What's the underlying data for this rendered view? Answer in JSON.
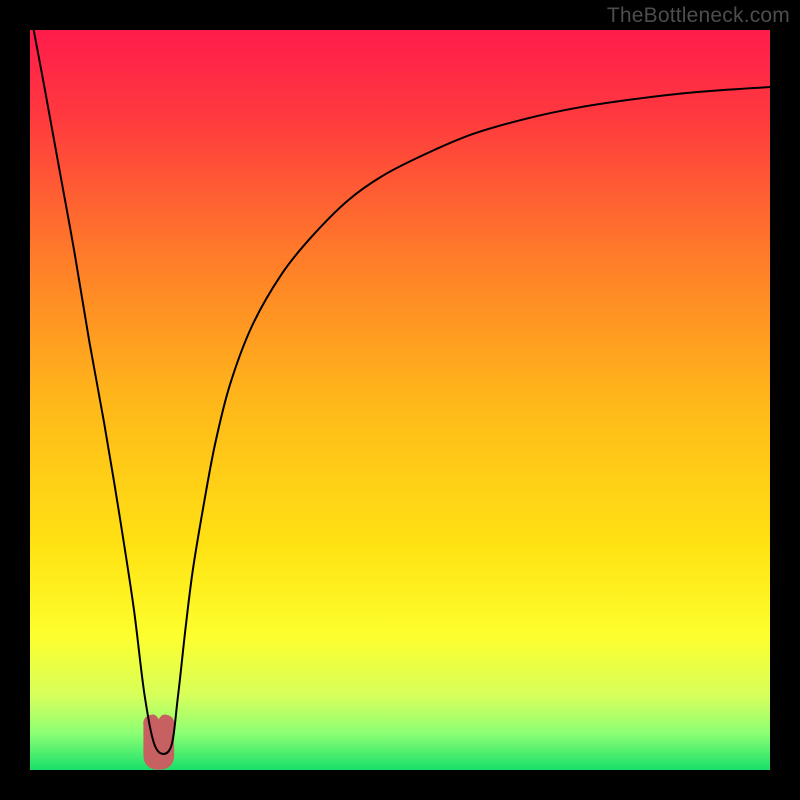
{
  "watermark": "TheBottleneck.com",
  "chart_data": {
    "type": "line",
    "title": "",
    "xlabel": "",
    "ylabel": "",
    "xlim": [
      0,
      100
    ],
    "ylim": [
      0,
      100
    ],
    "grid": false,
    "legend": false,
    "background": {
      "type": "vertical-gradient",
      "stops": [
        {
          "offset": 0.0,
          "color": "#ff1c4b"
        },
        {
          "offset": 0.12,
          "color": "#ff3a3e"
        },
        {
          "offset": 0.3,
          "color": "#ff7a2a"
        },
        {
          "offset": 0.5,
          "color": "#ffb71a"
        },
        {
          "offset": 0.7,
          "color": "#ffe313"
        },
        {
          "offset": 0.82,
          "color": "#fdff2e"
        },
        {
          "offset": 0.9,
          "color": "#d6ff5b"
        },
        {
          "offset": 0.95,
          "color": "#8dff74"
        },
        {
          "offset": 1.0,
          "color": "#18e06a"
        }
      ]
    },
    "series": [
      {
        "name": "bottleneck-curve",
        "stroke": "#000000",
        "stroke_width": 2,
        "x": [
          0.5,
          2,
          4,
          6,
          8,
          10,
          12,
          14,
          15.5,
          17,
          19,
          20,
          21,
          22,
          23.5,
          25,
          27,
          30,
          34,
          38,
          43,
          48,
          54,
          60,
          67,
          74,
          82,
          90,
          100
        ],
        "y": [
          100,
          92,
          81,
          70,
          58,
          47,
          35,
          22,
          10,
          3,
          3,
          10,
          19,
          27,
          36,
          44,
          52,
          60,
          67,
          72,
          77,
          80.5,
          83.5,
          86,
          88,
          89.5,
          90.7,
          91.6,
          92.3
        ]
      }
    ],
    "markers": [
      {
        "name": "min-marker",
        "shape": "u-blob",
        "x_center": 17.4,
        "x_halfwidth": 1.6,
        "y_top": 6.5,
        "y_bottom": 0.5,
        "fill": "#c76060",
        "stroke": "#c76060"
      }
    ]
  }
}
